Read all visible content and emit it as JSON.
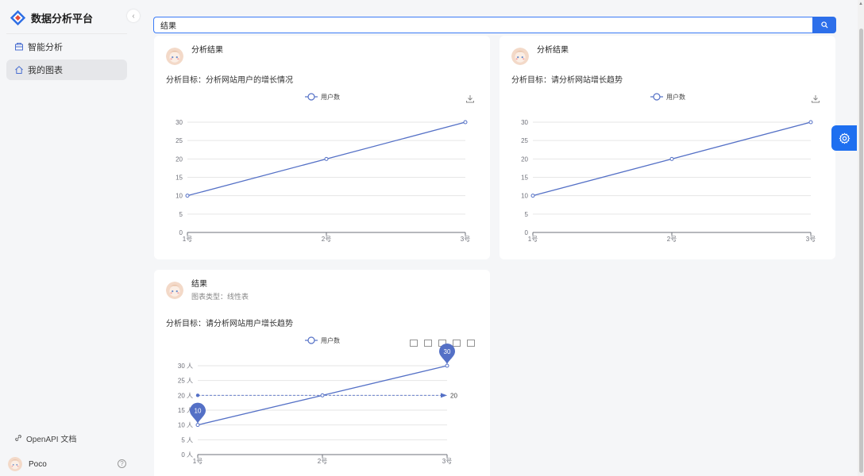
{
  "app": {
    "title": "数据分析平台"
  },
  "sidebar": {
    "collapse_icon": "chevron-left-icon",
    "items": [
      {
        "label": "智能分析",
        "icon": "chart-icon",
        "active": false
      },
      {
        "label": "我的图表",
        "icon": "home-icon",
        "active": true
      }
    ],
    "openapi_label": "OpenAPI 文档",
    "user_name": "Poco",
    "help_icon": "?"
  },
  "search": {
    "value": "结果",
    "icon": "search-icon"
  },
  "colors": {
    "accent": "#2d6fea",
    "series": "#5470c6"
  },
  "cards": [
    {
      "title": "分析结果",
      "goal_label": "分析目标：",
      "goal": "分析网站用户的增长情况",
      "toolbox_icons": [
        "download-icon"
      ],
      "chart_data": {
        "type": "line",
        "categories": [
          "1号",
          "2号",
          "3号"
        ],
        "series": [
          {
            "name": "用户数",
            "values": [
              10,
              20,
              30
            ]
          }
        ],
        "yticks": [
          "0",
          "5",
          "10",
          "15",
          "20",
          "25",
          "30"
        ],
        "ylim": [
          0,
          30
        ],
        "legend": "top-center"
      }
    },
    {
      "title": "分析结果",
      "goal_label": "分析目标：",
      "goal": "请分析网站增长趋势",
      "toolbox_icons": [
        "download-icon"
      ],
      "chart_data": {
        "type": "line",
        "categories": [
          "1号",
          "2号",
          "3号"
        ],
        "series": [
          {
            "name": "用户数",
            "values": [
              10,
              20,
              30
            ]
          }
        ],
        "yticks": [
          "0",
          "5",
          "10",
          "15",
          "20",
          "25",
          "30"
        ],
        "ylim": [
          0,
          30
        ],
        "legend": "top-center"
      }
    },
    {
      "title": "结果",
      "subtitle": "图表类型：线性表",
      "goal_label": "分析目标：",
      "goal": "请分析网站用户增长趋势",
      "toolbox_icons": [
        "zoom-icon",
        "zoom-reset-icon",
        "line-icon",
        "bar-icon",
        "save-icon"
      ],
      "chart_data": {
        "type": "line",
        "categories": [
          "1号",
          "2号",
          "3号"
        ],
        "series": [
          {
            "name": "用户数",
            "values": [
              10,
              20,
              30
            ]
          }
        ],
        "yticks": [
          "0 人",
          "5 人",
          "10 人",
          "15 人",
          "20 人",
          "25 人",
          "30 人"
        ],
        "ylim": [
          0,
          30
        ],
        "mark_points": [
          {
            "label": "10",
            "value": 10,
            "index": 0
          },
          {
            "label": "30",
            "value": 30,
            "index": 2
          }
        ],
        "mark_line": {
          "label": "20",
          "value": 20
        },
        "legend": "top-center"
      }
    }
  ],
  "float_button": {
    "icon": "gear-icon"
  }
}
